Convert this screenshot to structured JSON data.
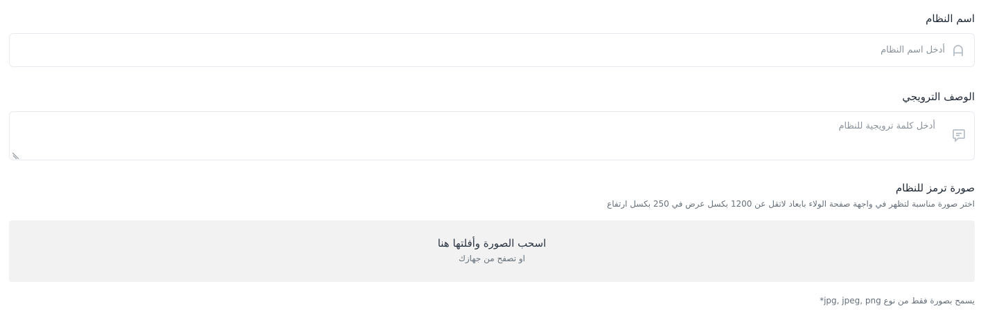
{
  "system_name": {
    "label": "اسم النظام",
    "placeholder": "أدخل اسم النظام",
    "icon": "user-icon"
  },
  "promo_description": {
    "label": "الوصف الترويجي",
    "placeholder": "أدخل كلمة ترويجية للنظام",
    "icon": "message-icon"
  },
  "system_image": {
    "label": "صورة ترمز للنظام",
    "hint": "اختر صورة مناسبة لتظهر في واجهة صفحة الولاء بابعاد لاتقل عن 1200 بكسل عرض في 250 بكسل ارتفاع",
    "dropzone_title": "اسحب الصورة وأفلتها هنا",
    "dropzone_subtitle": "او تصفح من جهازك",
    "footnote": "يسمح بصورة فقط من نوع jpg, jpeg, png*"
  },
  "colors": {
    "border": "#e7eaee",
    "dropzone_bg": "#f2f2f2",
    "text": "#1d2633",
    "muted": "#66707a",
    "placeholder": "#8a929b"
  }
}
